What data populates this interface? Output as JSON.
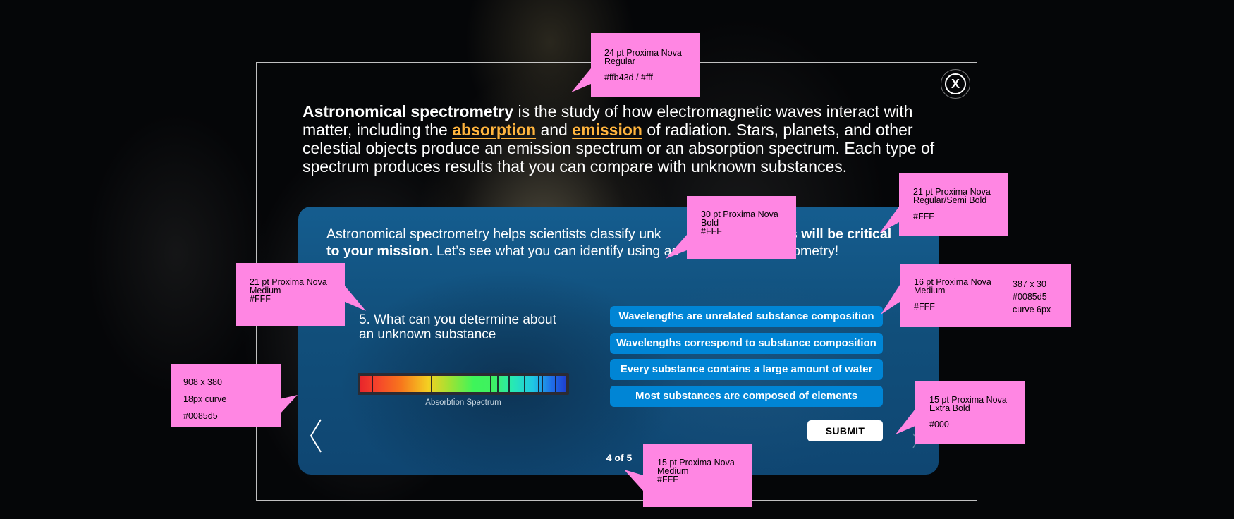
{
  "intro": {
    "lead": "Astronomical spectrometry",
    "t1": " is the study of how electromagnetic waves interact with matter, including the ",
    "term1": "absorption",
    "t2": " and ",
    "term2": "emission",
    "t3": " of radiation. Stars, planets, and other celestial objects produce an emission spectrum or an absorption spectrum. Each type of spectrum produces results that you can compare with unknown substances."
  },
  "panel": {
    "t1": "Astronomical spectrometry helps scientists classify unk",
    "bold1": "his will be critical",
    "t2": " ",
    "bold2": "to your mission",
    "t3": ". Let’s see what you can identify using as",
    "t4": "trometry!"
  },
  "question": {
    "text": "5. What can you determine about an unknown substance"
  },
  "spectrum": {
    "label": "Absorbtion Spectrum"
  },
  "answers": [
    "Wavelengths are unrelated substance composition",
    "Wavelengths correspond to substance composition",
    "Every substance contains a large amount of water",
    "Most substances are composed of elements"
  ],
  "submit_label": "SUBMIT",
  "close_label": "X",
  "pager": {
    "text": "4 of 5"
  },
  "annotations": {
    "top": {
      "l1": "24 pt Proxima Nova\nRegular",
      "l2": "#ffb43d / #fff"
    },
    "panel_text": {
      "l1": "30 pt Proxima Nova\nBold\n#FFF"
    },
    "intro_right": {
      "l1": "21 pt Proxima Nova\nRegular/Semi Bold",
      "l2": "#FFF"
    },
    "question": {
      "l1": "21 pt Proxima Nova\nMedium\n#FFF"
    },
    "answers_font": {
      "l1": "16 pt Proxima Nova\nMedium",
      "l2": "#FFF"
    },
    "answers_box": {
      "l1": "387 x 30\n#0085d5\ncurve 6px"
    },
    "panel_box": {
      "l1": "908 x 380",
      "l2": "18px curve",
      "l3": "#0085d5"
    },
    "submit": {
      "l1": "15 pt Proxima Nova\nExtra Bold",
      "l2": "#000"
    },
    "pager": {
      "l1": "15 pt Proxima Nova\nMedium\n#FFF"
    }
  },
  "colors": {
    "accent": "#ffb43d",
    "answer_bg": "#0085d5",
    "annotation_bg": "#ff86e3"
  },
  "icons": {
    "close": "close-icon",
    "prev": "chevron-left-icon",
    "next": "chevron-right-icon"
  }
}
